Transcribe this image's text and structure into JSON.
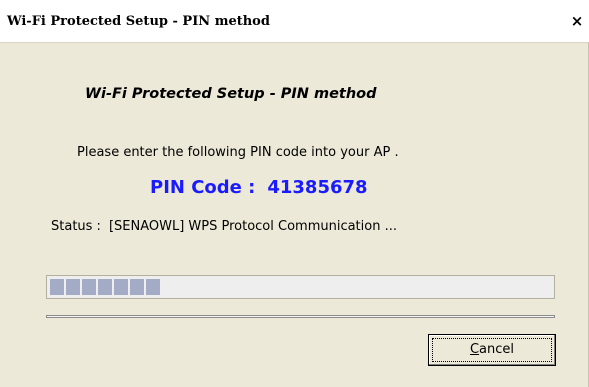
{
  "window": {
    "title": "Wi-Fi Protected Setup - PIN method",
    "close_glyph": "×"
  },
  "content": {
    "header": "Wi-Fi Protected Setup - PIN method",
    "instruction": "Please enter the following PIN code into your AP .",
    "pin_label": "PIN Code :",
    "pin_value": "41385678",
    "status_label": "Status :",
    "status_value": "[SENAOWL] WPS Protocol Communication ..."
  },
  "progress": {
    "filled_blocks": 7,
    "fraction": 0.22
  },
  "buttons": {
    "cancel_mnemonic": "C",
    "cancel_rest": "ancel"
  },
  "colors": {
    "pin_text": "#1a1aff",
    "progress_fill": "#a4abc5",
    "dialog_bg": "#ece9d8"
  }
}
